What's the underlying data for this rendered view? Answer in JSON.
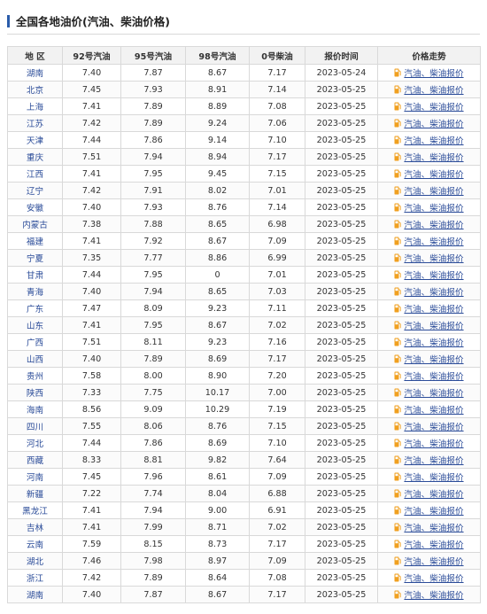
{
  "title": "全国各地油价(汽油、柴油价格)",
  "columns": [
    "地 区",
    "92号汽油",
    "95号汽油",
    "98号汽油",
    "0号柴油",
    "报价时间",
    "价格走势"
  ],
  "link_text": "汽油、柴油报价",
  "rows": [
    {
      "region": "湖南",
      "p92": "7.40",
      "p95": "7.87",
      "p98": "8.67",
      "diesel": "7.17",
      "date": "2023-05-24"
    },
    {
      "region": "北京",
      "p92": "7.45",
      "p95": "7.93",
      "p98": "8.91",
      "diesel": "7.14",
      "date": "2023-05-25"
    },
    {
      "region": "上海",
      "p92": "7.41",
      "p95": "7.89",
      "p98": "8.89",
      "diesel": "7.08",
      "date": "2023-05-25"
    },
    {
      "region": "江苏",
      "p92": "7.42",
      "p95": "7.89",
      "p98": "9.24",
      "diesel": "7.06",
      "date": "2023-05-25"
    },
    {
      "region": "天津",
      "p92": "7.44",
      "p95": "7.86",
      "p98": "9.14",
      "diesel": "7.10",
      "date": "2023-05-25"
    },
    {
      "region": "重庆",
      "p92": "7.51",
      "p95": "7.94",
      "p98": "8.94",
      "diesel": "7.17",
      "date": "2023-05-25"
    },
    {
      "region": "江西",
      "p92": "7.41",
      "p95": "7.95",
      "p98": "9.45",
      "diesel": "7.15",
      "date": "2023-05-25"
    },
    {
      "region": "辽宁",
      "p92": "7.42",
      "p95": "7.91",
      "p98": "8.02",
      "diesel": "7.01",
      "date": "2023-05-25"
    },
    {
      "region": "安徽",
      "p92": "7.40",
      "p95": "7.93",
      "p98": "8.76",
      "diesel": "7.14",
      "date": "2023-05-25"
    },
    {
      "region": "内蒙古",
      "p92": "7.38",
      "p95": "7.88",
      "p98": "8.65",
      "diesel": "6.98",
      "date": "2023-05-25"
    },
    {
      "region": "福建",
      "p92": "7.41",
      "p95": "7.92",
      "p98": "8.67",
      "diesel": "7.09",
      "date": "2023-05-25"
    },
    {
      "region": "宁夏",
      "p92": "7.35",
      "p95": "7.77",
      "p98": "8.86",
      "diesel": "6.99",
      "date": "2023-05-25"
    },
    {
      "region": "甘肃",
      "p92": "7.44",
      "p95": "7.95",
      "p98": "0",
      "diesel": "7.01",
      "date": "2023-05-25"
    },
    {
      "region": "青海",
      "p92": "7.40",
      "p95": "7.94",
      "p98": "8.65",
      "diesel": "7.03",
      "date": "2023-05-25"
    },
    {
      "region": "广东",
      "p92": "7.47",
      "p95": "8.09",
      "p98": "9.23",
      "diesel": "7.11",
      "date": "2023-05-25"
    },
    {
      "region": "山东",
      "p92": "7.41",
      "p95": "7.95",
      "p98": "8.67",
      "diesel": "7.02",
      "date": "2023-05-25"
    },
    {
      "region": "广西",
      "p92": "7.51",
      "p95": "8.11",
      "p98": "9.23",
      "diesel": "7.16",
      "date": "2023-05-25"
    },
    {
      "region": "山西",
      "p92": "7.40",
      "p95": "7.89",
      "p98": "8.69",
      "diesel": "7.17",
      "date": "2023-05-25"
    },
    {
      "region": "贵州",
      "p92": "7.58",
      "p95": "8.00",
      "p98": "8.90",
      "diesel": "7.20",
      "date": "2023-05-25"
    },
    {
      "region": "陕西",
      "p92": "7.33",
      "p95": "7.75",
      "p98": "10.17",
      "diesel": "7.00",
      "date": "2023-05-25"
    },
    {
      "region": "海南",
      "p92": "8.56",
      "p95": "9.09",
      "p98": "10.29",
      "diesel": "7.19",
      "date": "2023-05-25"
    },
    {
      "region": "四川",
      "p92": "7.55",
      "p95": "8.06",
      "p98": "8.76",
      "diesel": "7.15",
      "date": "2023-05-25"
    },
    {
      "region": "河北",
      "p92": "7.44",
      "p95": "7.86",
      "p98": "8.69",
      "diesel": "7.10",
      "date": "2023-05-25"
    },
    {
      "region": "西藏",
      "p92": "8.33",
      "p95": "8.81",
      "p98": "9.82",
      "diesel": "7.64",
      "date": "2023-05-25"
    },
    {
      "region": "河南",
      "p92": "7.45",
      "p95": "7.96",
      "p98": "8.61",
      "diesel": "7.09",
      "date": "2023-05-25"
    },
    {
      "region": "新疆",
      "p92": "7.22",
      "p95": "7.74",
      "p98": "8.04",
      "diesel": "6.88",
      "date": "2023-05-25"
    },
    {
      "region": "黑龙江",
      "p92": "7.41",
      "p95": "7.94",
      "p98": "9.00",
      "diesel": "6.91",
      "date": "2023-05-25"
    },
    {
      "region": "吉林",
      "p92": "7.41",
      "p95": "7.99",
      "p98": "8.71",
      "diesel": "7.02",
      "date": "2023-05-25"
    },
    {
      "region": "云南",
      "p92": "7.59",
      "p95": "8.15",
      "p98": "8.73",
      "diesel": "7.17",
      "date": "2023-05-25"
    },
    {
      "region": "湖北",
      "p92": "7.46",
      "p95": "7.98",
      "p98": "8.97",
      "diesel": "7.09",
      "date": "2023-05-25"
    },
    {
      "region": "浙江",
      "p92": "7.42",
      "p95": "7.89",
      "p98": "8.64",
      "diesel": "7.08",
      "date": "2023-05-25"
    },
    {
      "region": "湖南",
      "p92": "7.40",
      "p95": "7.87",
      "p98": "8.67",
      "diesel": "7.17",
      "date": "2023-05-25"
    }
  ],
  "icon": "fuel-pump-icon",
  "colors": {
    "accent": "#2a5caa",
    "link": "#2b4c99",
    "icon": "#f0a020"
  }
}
